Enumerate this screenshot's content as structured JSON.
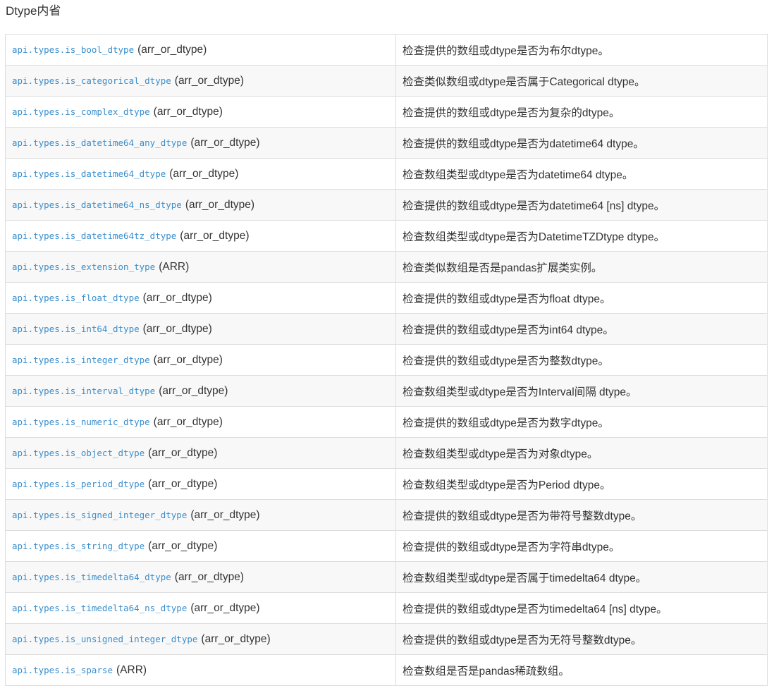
{
  "section": {
    "title": "Dtype内省"
  },
  "rows": [
    {
      "name": "api.types.is_bool_dtype",
      "args": "(arr_or_dtype)",
      "desc": "检查提供的数组或dtype是否为布尔dtype。"
    },
    {
      "name": "api.types.is_categorical_dtype",
      "args": "(arr_or_dtype)",
      "desc": "检查类似数组或dtype是否属于Categorical dtype。"
    },
    {
      "name": "api.types.is_complex_dtype",
      "args": "(arr_or_dtype)",
      "desc": "检查提供的数组或dtype是否为复杂的dtype。"
    },
    {
      "name": "api.types.is_datetime64_any_dtype",
      "args": "(arr_or_dtype)",
      "desc": "检查提供的数组或dtype是否为datetime64 dtype。"
    },
    {
      "name": "api.types.is_datetime64_dtype",
      "args": "(arr_or_dtype)",
      "desc": "检查数组类型或dtype是否为datetime64 dtype。"
    },
    {
      "name": "api.types.is_datetime64_ns_dtype",
      "args": "(arr_or_dtype)",
      "desc": "检查提供的数组或dtype是否为datetime64 [ns] dtype。"
    },
    {
      "name": "api.types.is_datetime64tz_dtype",
      "args": "(arr_or_dtype)",
      "desc": "检查数组类型或dtype是否为DatetimeTZDtype dtype。"
    },
    {
      "name": "api.types.is_extension_type",
      "args": "(ARR)",
      "desc": "检查类似数组是否是pandas扩展类实例。"
    },
    {
      "name": "api.types.is_float_dtype",
      "args": "(arr_or_dtype)",
      "desc": "检查提供的数组或dtype是否为float dtype。"
    },
    {
      "name": "api.types.is_int64_dtype",
      "args": "(arr_or_dtype)",
      "desc": "检查提供的数组或dtype是否为int64 dtype。"
    },
    {
      "name": "api.types.is_integer_dtype",
      "args": "(arr_or_dtype)",
      "desc": "检查提供的数组或dtype是否为整数dtype。"
    },
    {
      "name": "api.types.is_interval_dtype",
      "args": "(arr_or_dtype)",
      "desc": "检查数组类型或dtype是否为Interval间隔 dtype。"
    },
    {
      "name": "api.types.is_numeric_dtype",
      "args": "(arr_or_dtype)",
      "desc": "检查提供的数组或dtype是否为数字dtype。"
    },
    {
      "name": "api.types.is_object_dtype",
      "args": "(arr_or_dtype)",
      "desc": "检查数组类型或dtype是否为对象dtype。"
    },
    {
      "name": "api.types.is_period_dtype",
      "args": "(arr_or_dtype)",
      "desc": "检查数组类型或dtype是否为Period dtype。"
    },
    {
      "name": "api.types.is_signed_integer_dtype",
      "args": "(arr_or_dtype)",
      "desc": "检查提供的数组或dtype是否为带符号整数dtype。"
    },
    {
      "name": "api.types.is_string_dtype",
      "args": "(arr_or_dtype)",
      "desc": "检查提供的数组或dtype是否为字符串dtype。"
    },
    {
      "name": "api.types.is_timedelta64_dtype",
      "args": "(arr_or_dtype)",
      "desc": "检查数组类型或dtype是否属于timedelta64 dtype。"
    },
    {
      "name": "api.types.is_timedelta64_ns_dtype",
      "args": "(arr_or_dtype)",
      "desc": "检查提供的数组或dtype是否为timedelta64 [ns] dtype。"
    },
    {
      "name": "api.types.is_unsigned_integer_dtype",
      "args": "(arr_or_dtype)",
      "desc": "检查提供的数组或dtype是否为无符号整数dtype。"
    },
    {
      "name": "api.types.is_sparse",
      "args": "(ARR)",
      "desc": "检查数组是否是pandas稀疏数组。"
    }
  ],
  "colors": {
    "link": "#3a8ecc",
    "text": "#333333",
    "border": "#dddddd",
    "stripe": "#f8f8f8"
  }
}
